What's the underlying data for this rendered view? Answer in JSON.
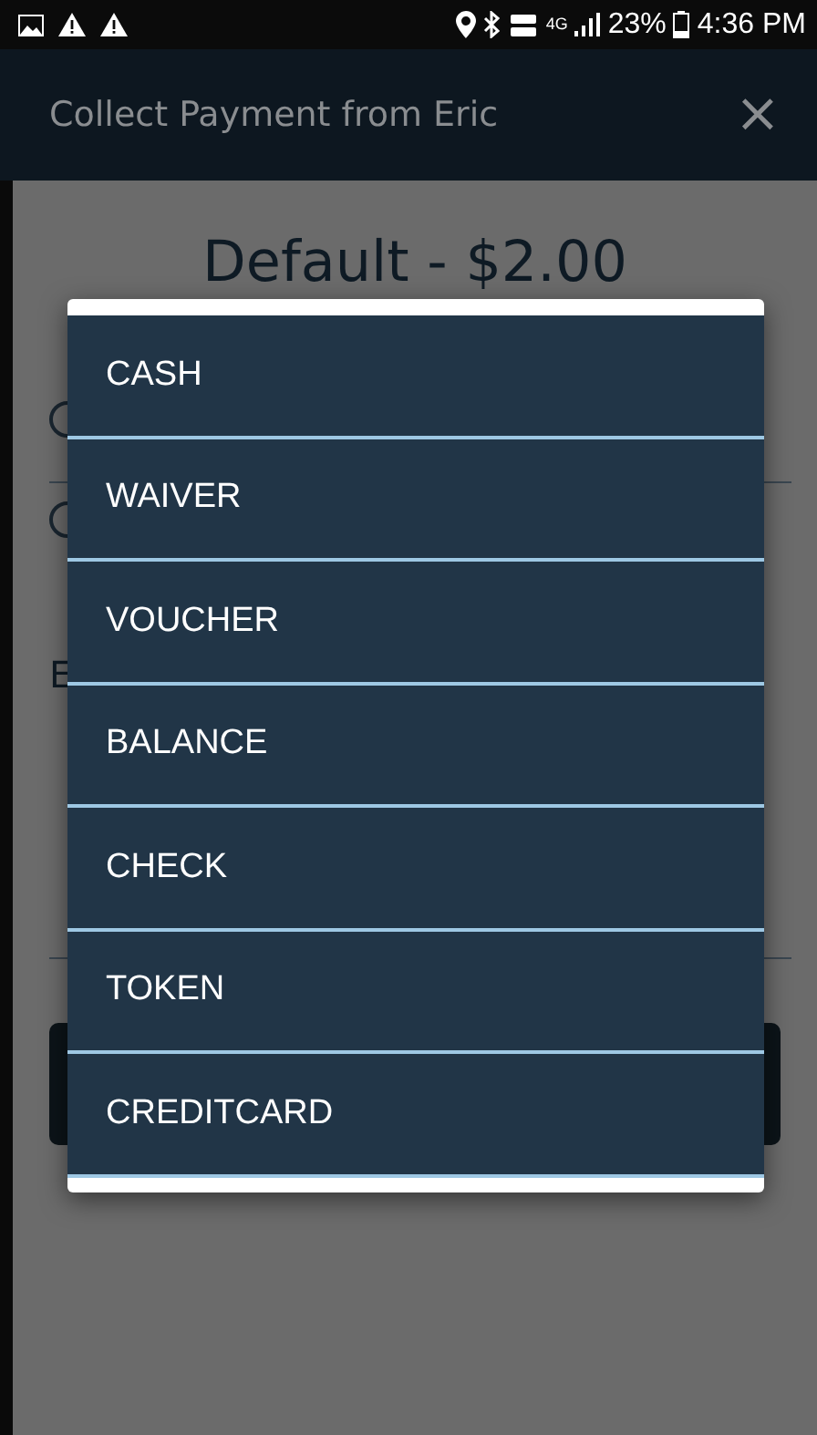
{
  "status_bar": {
    "battery": "23%",
    "time": "4:36 PM",
    "network": "4G"
  },
  "header": {
    "title": "Collect Payment from Eric",
    "close": "×"
  },
  "background": {
    "heading": "Default - $2.00",
    "radios": [
      {
        "checked": false
      },
      {
        "checked": false
      }
    ],
    "section_label": "E"
  },
  "dialog": {
    "items": [
      {
        "label": "CASH"
      },
      {
        "label": "WAIVER"
      },
      {
        "label": "VOUCHER"
      },
      {
        "label": "BALANCE"
      },
      {
        "label": "CHECK"
      },
      {
        "label": "TOKEN"
      },
      {
        "label": "CREDITCARD"
      }
    ]
  }
}
